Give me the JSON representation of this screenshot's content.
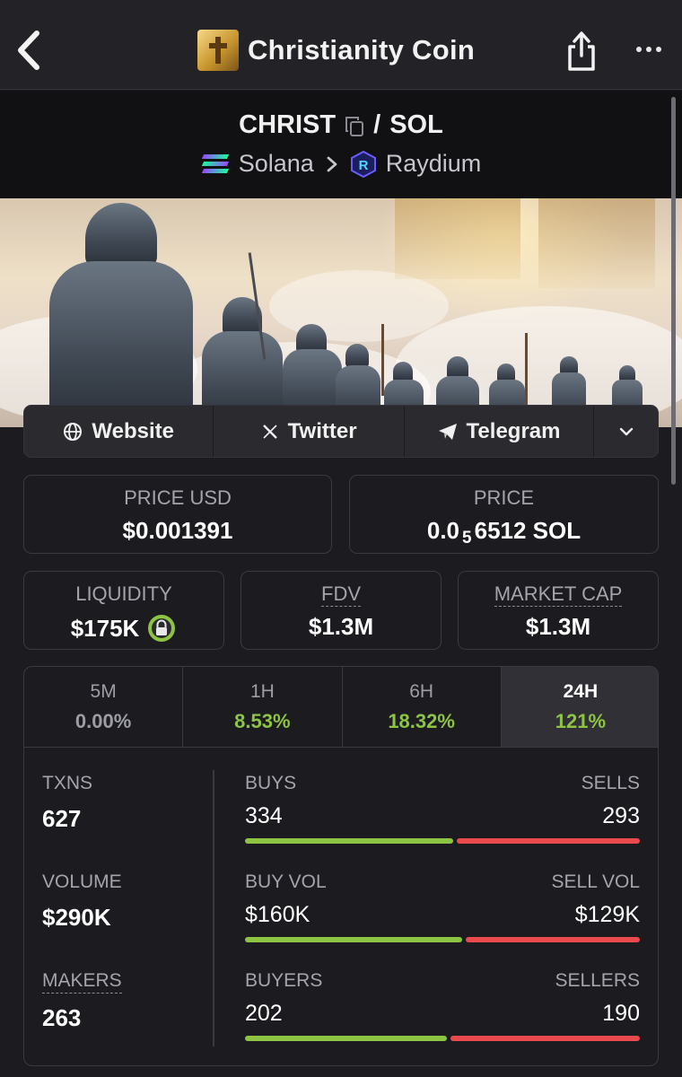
{
  "header": {
    "title": "Christianity Coin",
    "back_icon": "chevron-left-icon",
    "share_icon": "share-icon",
    "more_icon": "more-dots-icon"
  },
  "pair": {
    "base": "CHRIST",
    "separator": "/",
    "quote": "SOL",
    "chain": "Solana",
    "dex": "Raydium"
  },
  "links": {
    "website": "Website",
    "twitter": "Twitter",
    "telegram": "Telegram"
  },
  "price": {
    "usd_label": "PRICE USD",
    "usd_value": "$0.001391",
    "native_label": "PRICE",
    "native_prefix": "0.0",
    "native_zeros": "5",
    "native_digits": "6512 SOL"
  },
  "metrics": {
    "liquidity_label": "LIQUIDITY",
    "liquidity_value": "$175K",
    "fdv_label": "FDV",
    "fdv_value": "$1.3M",
    "mcap_label": "MARKET CAP",
    "mcap_value": "$1.3M"
  },
  "timeframes": [
    {
      "label": "5M",
      "value": "0.00%",
      "color": "#9d9da5",
      "active": false
    },
    {
      "label": "1H",
      "value": "8.53%",
      "color": "#8dc443",
      "active": false
    },
    {
      "label": "6H",
      "value": "18.32%",
      "color": "#8dc443",
      "active": false
    },
    {
      "label": "24H",
      "value": "121%",
      "color": "#8dc443",
      "active": true
    }
  ],
  "stats": {
    "txns_label": "TXNS",
    "txns_value": "627",
    "volume_label": "VOLUME",
    "volume_value": "$290K",
    "makers_label": "MAKERS",
    "makers_value": "263",
    "buys_label": "BUYS",
    "buys_value": "334",
    "sells_label": "SELLS",
    "sells_value": "293",
    "buy_vol_label": "BUY VOL",
    "buy_vol_value": "$160K",
    "sell_vol_label": "SELL VOL",
    "sell_vol_value": "$129K",
    "buyers_label": "BUYERS",
    "buyers_value": "202",
    "sellers_label": "SELLERS",
    "sellers_value": "190"
  },
  "ratios": {
    "buys_share": 0.533,
    "buy_vol_share": 0.554,
    "buyers_share": 0.515
  },
  "colors": {
    "positive": "#8dc443",
    "negative": "#ea4a4d",
    "background": "#1b1b20"
  }
}
